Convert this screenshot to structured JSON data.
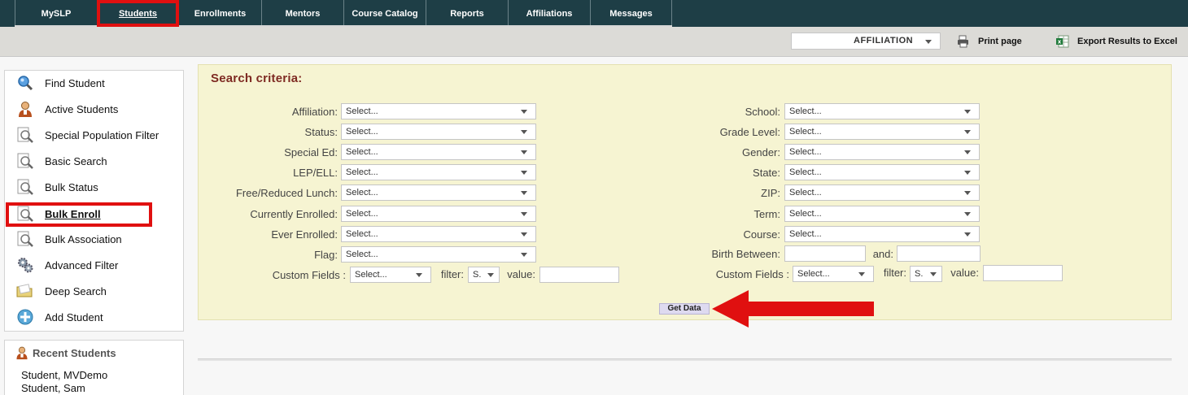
{
  "nav": {
    "items": [
      "MySLP",
      "Students",
      "Enrollments",
      "Mentors",
      "Course Catalog",
      "Reports",
      "Affiliations",
      "Messages"
    ],
    "active": "Students"
  },
  "toolbar": {
    "affiliation_select": "AFFILIATION",
    "print_label": "Print page",
    "export_label": "Export Results to Excel"
  },
  "sidebar": {
    "items": [
      "Find Student",
      "Active Students",
      "Special Population Filter",
      "Basic Search",
      "Bulk Status",
      "Bulk Enroll",
      "Bulk Association",
      "Advanced Filter",
      "Deep Search",
      "Add Student"
    ],
    "active": "Bulk Enroll"
  },
  "recent": {
    "title": "Recent Students",
    "items": [
      "Student, MVDemo",
      "Student, Sam"
    ]
  },
  "search": {
    "title": "Search criteria:",
    "left_labels": [
      "Affiliation:",
      "Status:",
      "Special Ed:",
      "LEP/ELL:",
      "Free/Reduced Lunch:",
      "Currently Enrolled:",
      "Ever Enrolled:",
      "Flag:"
    ],
    "right_labels": [
      "School:",
      "Grade Level:",
      "Gender:",
      "State:",
      "ZIP:",
      "Term:",
      "Course:"
    ],
    "birth_between_label": "Birth Between:",
    "and_label": "and:",
    "custom_fields_label": "Custom Fields :",
    "filter_label": "filter:",
    "value_label": "value:",
    "select_placeholder": "Select...",
    "filter_short": "S.",
    "get_data_label": "Get Data"
  },
  "colors": {
    "nav_bg": "#1e3e46",
    "highlight": "#e01010",
    "panel_bg": "#f6f4d2",
    "title": "#7e2a22"
  }
}
